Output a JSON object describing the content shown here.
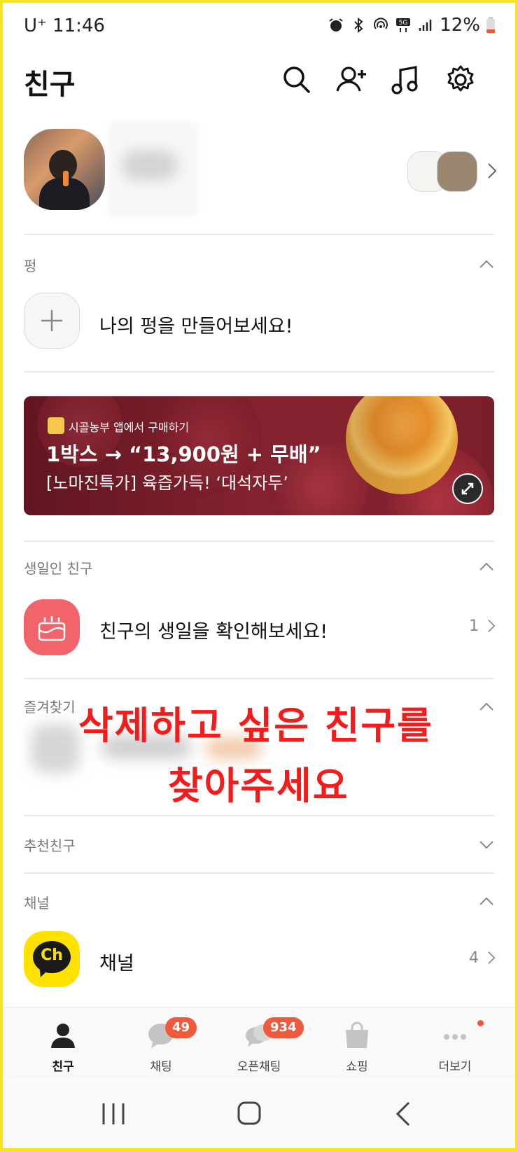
{
  "status_bar": {
    "carrier_time": "U⁺ 11:46",
    "battery": "12%"
  },
  "header": {
    "title": "친구"
  },
  "sections": {
    "pung": {
      "label": "펑",
      "add_text": "나의 펑을 만들어보세요!"
    },
    "banner": {
      "source": "시골농부 앱에서 구매하기",
      "headline": "1박스 → “13,900원 + 무배”",
      "subtext": "[노마진특가] 육즙가득! ‘대석자두’"
    },
    "birthday": {
      "label": "생일인 친구",
      "text": "친구의 생일을 확인해보세요!",
      "count": "1"
    },
    "favorites": {
      "label": "즐겨찾기"
    },
    "recommended": {
      "label": "추천친구"
    },
    "channel": {
      "label": "채널",
      "text": "채널",
      "count": "4",
      "icon_text": "Ch"
    }
  },
  "overlay": {
    "line1": "삭제하고 싶은 친구를",
    "line2": "찾아주세요"
  },
  "bottom_nav": [
    {
      "label": "친구",
      "icon": "person-icon",
      "active": true
    },
    {
      "label": "채팅",
      "icon": "chat-icon",
      "badge": "49"
    },
    {
      "label": "오픈채팅",
      "icon": "open-chat-icon",
      "badge": "934"
    },
    {
      "label": "쇼핑",
      "icon": "shopping-bag-icon"
    },
    {
      "label": "더보기",
      "icon": "more-icon"
    }
  ],
  "colors": {
    "accent_yellow": "#ffe100",
    "badge_red": "#f05a3c",
    "overlay_red": "#f21c1c"
  }
}
